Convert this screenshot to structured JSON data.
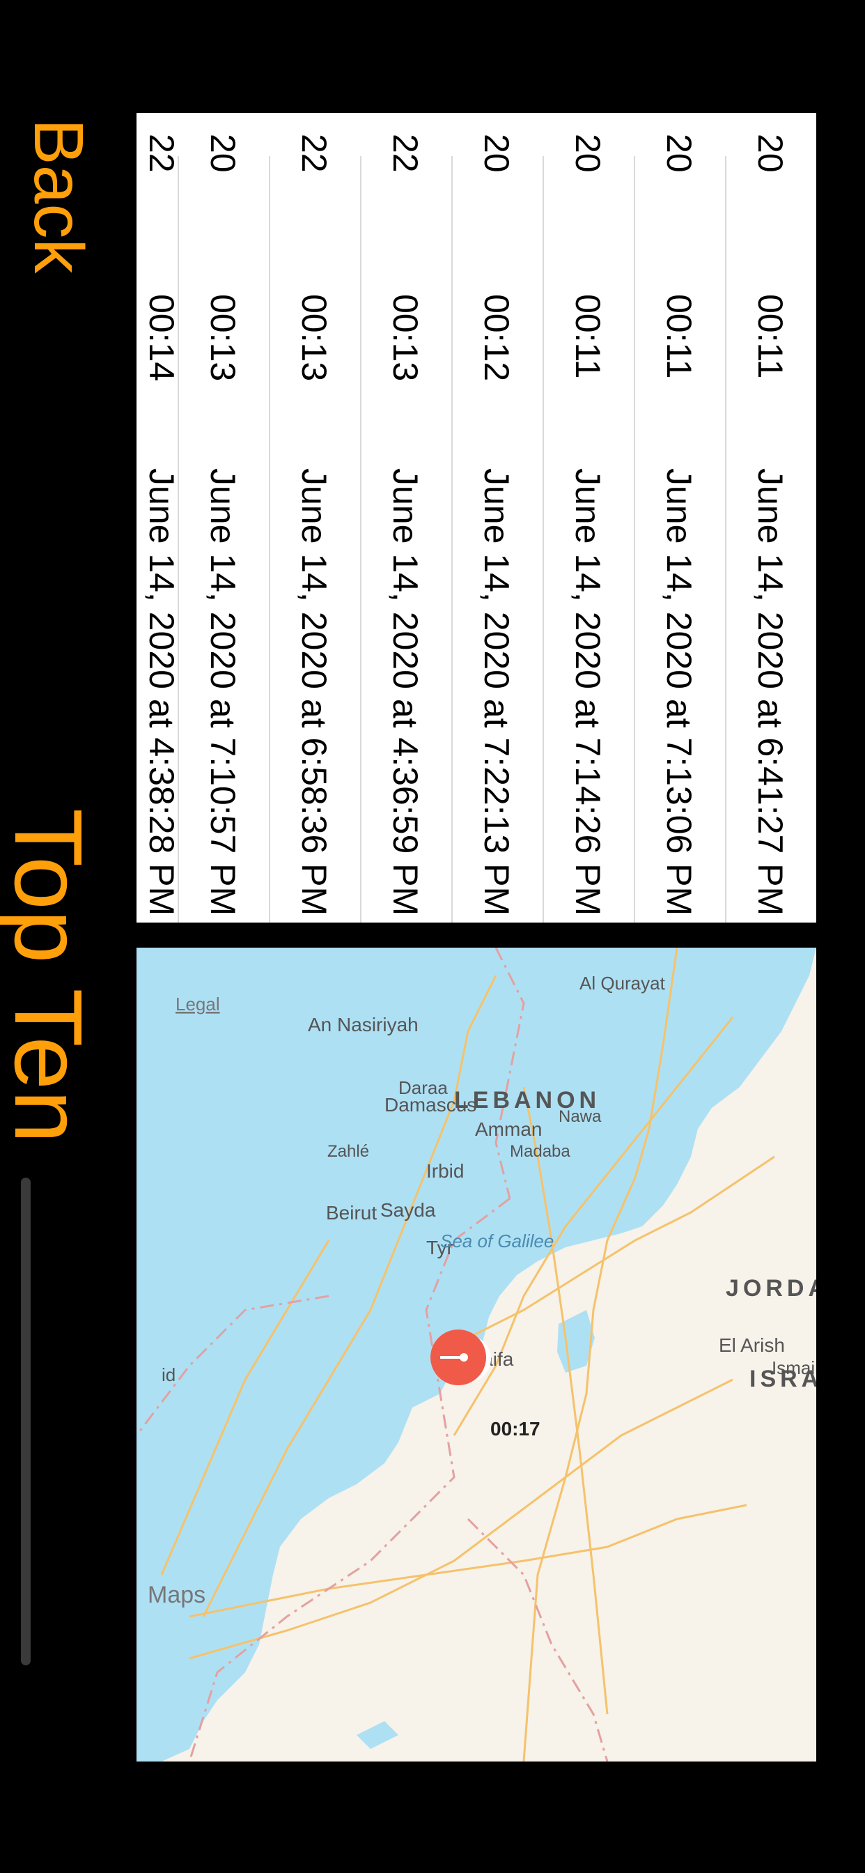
{
  "header": {
    "back_label": "Back",
    "title": "Top Ten"
  },
  "colors": {
    "accent": "#ff9f0a",
    "sea": "#aee0f4",
    "land": "#f7f2ea",
    "road": "#f5c26b",
    "pin": "#f05a48"
  },
  "rows": [
    {
      "c1": "20",
      "c2": "00:11",
      "c3": "June 14, 2020 at 6:41:27 PM"
    },
    {
      "c1": "20",
      "c2": "00:11",
      "c3": "June 14, 2020 at 7:13:06 PM"
    },
    {
      "c1": "20",
      "c2": "00:11",
      "c3": "June 14, 2020 at 7:14:26 PM"
    },
    {
      "c1": "20",
      "c2": "00:12",
      "c3": "June 14, 2020 at 7:22:13 PM"
    },
    {
      "c1": "22",
      "c2": "00:13",
      "c3": "June 14, 2020 at 4:36:59 PM"
    },
    {
      "c1": "22",
      "c2": "00:13",
      "c3": "June 14, 2020 at 6:58:36 PM"
    },
    {
      "c1": "20",
      "c2": "00:13",
      "c3": "June 14, 2020 at 7:10:57 PM"
    },
    {
      "c1": "22",
      "c2": "00:14",
      "c3": "June 14, 2020 at 4:38:28 PM"
    }
  ],
  "map": {
    "countries": [
      "LEBANON",
      "ISRAEL",
      "JORDAN"
    ],
    "cities": [
      "An Nasiriyah",
      "Damascus",
      "Zahlé",
      "Beirut",
      "Sayda",
      "Tyr",
      "Haifa",
      "Nawa",
      "Daraa",
      "Irbid",
      "Amman",
      "Madaba",
      "Al Qurayat",
      "El Arish",
      "Ismailia",
      "id"
    ],
    "sea_label": "Sea of Galilee",
    "pin_label": "00:17",
    "legal": "Legal",
    "brand": "Maps"
  }
}
